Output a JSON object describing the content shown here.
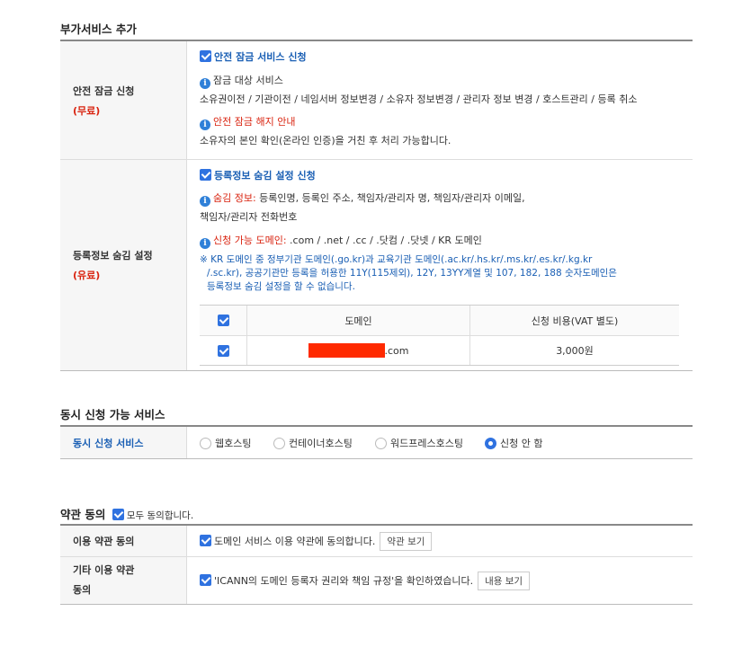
{
  "addon": {
    "title": "부가서비스 추가",
    "safe_lock": {
      "label": "안전 잠금 신청",
      "price": "(무료)",
      "checkbox_label": "안전 잠금 서비스 신청",
      "target_title": "잠금 대상 서비스",
      "target_desc": "소유권이전 / 기관이전 / 네임서버 정보변경 / 소유자 정보변경 / 관리자 정보 변경 / 호스트관리 / 등록 취소",
      "release_title": "안전 잠금 해지 안내",
      "release_desc": "소유자의 본인 확인(온라인 인증)을 거친 후 처리 가능합니다."
    },
    "privacy": {
      "label": "등록정보 숨김 설정",
      "price": "(유료)",
      "checkbox_label": "등록정보 숨김 설정 신청",
      "hide_title": "숨김 정보:",
      "hide_desc_1": " 등록인명, 등록인 주소, 책임자/관리자 명, 책임자/관리자 이메일,",
      "hide_desc_2": "책임자/관리자 전화번호",
      "avail_title": "신청 가능 도메인:",
      "avail_desc": " .com / .net / .cc / .닷컴 / .닷넷 / KR 도메인",
      "notice_1": "※ KR 도메인 중 정부기관 도메인(.go.kr)과 교육기관 도메인(.ac.kr/.hs.kr/.ms.kr/.es.kr/.kg.kr",
      "notice_2": "/.sc.kr), 공공기관만 등록을 허용한 11Y(115제외), 12Y, 13YY계열 및 107, 182, 188 숫자도메인은",
      "notice_3": "등록정보 숨김 설정을 할 수 없습니다.",
      "table": {
        "col_domain": "도메인",
        "col_price": "신청 비용(VAT 별도)",
        "rows": [
          {
            "domain_suffix": ".com",
            "price": "3,000원"
          }
        ]
      }
    }
  },
  "simul": {
    "title": "동시 신청 가능 서비스",
    "label": "동시 신청 서비스",
    "options": [
      "웹호스팅",
      "컨테이너호스팅",
      "워드프레스호스팅",
      "신청 안 함"
    ],
    "selected": "신청 안 함"
  },
  "terms": {
    "title": "약관 동의",
    "agree_all": "모두 동의합니다.",
    "row1_label": "이용 약관 동의",
    "row1_text": "도메인 서비스 이용 약관에 동의합니다.",
    "row1_button": "약관 보기",
    "row2_label_1": "기타 이용 약관",
    "row2_label_2": "동의",
    "row2_text": "'ICANN의 도메인 등록자 권리와 책임 규정'을 확인하였습니다.",
    "row2_button": "내용 보기"
  },
  "colors": {
    "accent": "#2f72e0",
    "red": "#d9230f",
    "link_blue": "#1a5fb4"
  }
}
